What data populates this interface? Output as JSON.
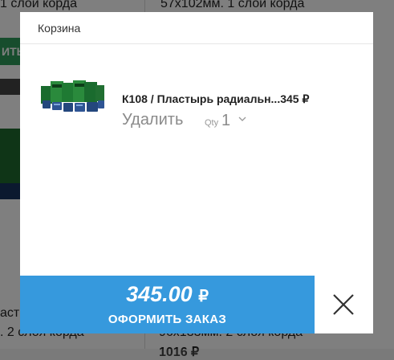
{
  "background": {
    "left_col_line1": "1 слой корда",
    "right_col_line1": "57х102мм. 1 слой корда",
    "button_fragment": "ИТЬ",
    "left_col_bottom1": "аст",
    "left_col_bottom2": ". 2 слоя корда",
    "right_col_bottom1": "96х133мм. 2 слоя корда",
    "right_col_bottom2": "1016 ₽"
  },
  "cart": {
    "title": "Корзина",
    "item": {
      "name": "К108 / Пластырь радиальн...",
      "price": "345 ₽",
      "remove_label": "Удалить",
      "qty_label": "Qty",
      "qty_value": "1"
    },
    "total": "345.00",
    "currency": "₽",
    "checkout_label": "ОФОРМИТЬ ЗАКАЗ"
  },
  "icons": {
    "close": "close-icon",
    "chevron": "chevron-down-icon"
  },
  "colors": {
    "checkout_bg": "#3699dd",
    "overlay": "rgba(0,0,0,0.5)"
  }
}
